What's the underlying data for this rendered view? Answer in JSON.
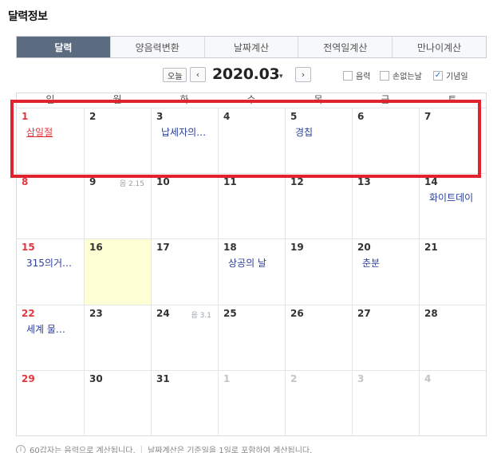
{
  "page": {
    "title": "달력정보"
  },
  "tabs": [
    {
      "label": "달력",
      "active": true
    },
    {
      "label": "양음력변환",
      "active": false
    },
    {
      "label": "날짜계산",
      "active": false
    },
    {
      "label": "전역일계산",
      "active": false
    },
    {
      "label": "만나이계산",
      "active": false
    }
  ],
  "toolbar": {
    "today_label": "오늘",
    "prev_icon": "‹",
    "next_icon": "›",
    "month_label": "2020.03",
    "month_caret": "▾",
    "options": [
      {
        "label": "음력",
        "checked": false
      },
      {
        "label": "손없는날",
        "checked": false
      },
      {
        "label": "기념일",
        "checked": true
      }
    ],
    "check_mark": "✓"
  },
  "calendar": {
    "weekdays": [
      "일",
      "월",
      "화",
      "수",
      "목",
      "금",
      "토"
    ],
    "weeks": [
      [
        {
          "day": "1",
          "sunday": true,
          "event": "삼일절",
          "holiday": true
        },
        {
          "day": "2"
        },
        {
          "day": "3",
          "event": "납세자의…"
        },
        {
          "day": "4"
        },
        {
          "day": "5",
          "event": "경칩"
        },
        {
          "day": "6"
        },
        {
          "day": "7"
        }
      ],
      [
        {
          "day": "8",
          "sunday": true
        },
        {
          "day": "9",
          "lunar": "음 2.15"
        },
        {
          "day": "10"
        },
        {
          "day": "11"
        },
        {
          "day": "12"
        },
        {
          "day": "13"
        },
        {
          "day": "14",
          "event": "화이트데이"
        }
      ],
      [
        {
          "day": "15",
          "sunday": true,
          "event": "315의거…"
        },
        {
          "day": "16",
          "today": true
        },
        {
          "day": "17"
        },
        {
          "day": "18",
          "event": "상공의 날"
        },
        {
          "day": "19"
        },
        {
          "day": "20",
          "event": "춘분"
        },
        {
          "day": "21"
        }
      ],
      [
        {
          "day": "22",
          "sunday": true,
          "event": "세계 물…"
        },
        {
          "day": "23"
        },
        {
          "day": "24",
          "lunar": "음 3.1"
        },
        {
          "day": "25"
        },
        {
          "day": "26"
        },
        {
          "day": "27"
        },
        {
          "day": "28"
        }
      ],
      [
        {
          "day": "29",
          "sunday": true
        },
        {
          "day": "30"
        },
        {
          "day": "31"
        },
        {
          "day": "1",
          "other": true
        },
        {
          "day": "2",
          "other": true
        },
        {
          "day": "3",
          "other": true
        },
        {
          "day": "4",
          "other": true
        }
      ]
    ]
  },
  "footer": {
    "info_icon": "i",
    "note1": "60갑자는 음력으로 계산됩니다.",
    "separator": "|",
    "note2": "날짜계산은 기준일을 1일로 포함하여 계산됩니다."
  },
  "colors": {
    "highlight": "#e32230",
    "active_tab": "#5b6b80",
    "sunday": "#e0383e",
    "event": "#2a3f9c",
    "today_bg": "#ffffd6"
  }
}
